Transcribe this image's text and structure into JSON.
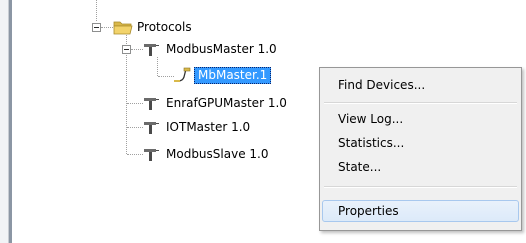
{
  "tree": {
    "protocols_label": "Protocols",
    "modbus_master_label": "ModbusMaster 1.0",
    "mbmaster_label": "MbMaster.1",
    "enraf_label": "EnrafGPUMaster 1.0",
    "iot_label": "IOTMaster 1.0",
    "modbus_slave_label": "ModbusSlave 1.0"
  },
  "context_menu": {
    "items": [
      "Find Devices...",
      "View Log...",
      "Statistics...",
      "State...",
      "Properties"
    ],
    "hovered_item": "Properties"
  },
  "colors": {
    "selection": "#3399ff",
    "menu_hover": "#dceaf9",
    "folder": "#f2d36b",
    "plug": "#6b6b6b",
    "device": "#d9b94a"
  },
  "icons": {
    "protocols": "folder-open-icon",
    "protocol_node": "plug-connector-icon",
    "device_node": "device-connector-icon"
  }
}
